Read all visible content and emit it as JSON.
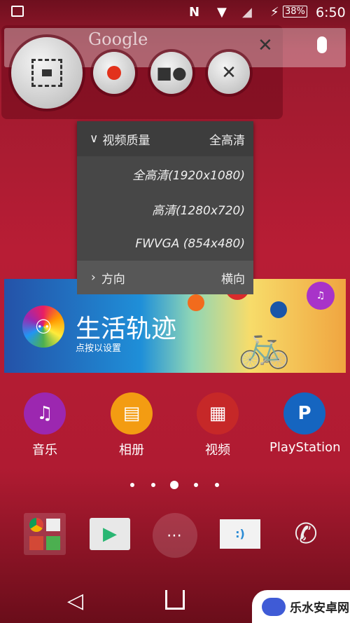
{
  "status_bar": {
    "time": "6:50",
    "battery": "38%",
    "icons": [
      "image-icon",
      "nfc-icon",
      "wifi-icon",
      "signal-icon",
      "charging-icon"
    ]
  },
  "search": {
    "placeholder": "Google"
  },
  "recorder": {
    "buttons": [
      "capture-screen-video-icon",
      "record-icon",
      "camera-person-icon",
      "settings-tools-icon"
    ],
    "record_color": "#e2321c"
  },
  "menu": {
    "header": {
      "label": "视频质量",
      "value": "全高清"
    },
    "options": [
      "全高清(1920x1080)",
      "高清(1280x720)",
      "FWVGA (854x480)"
    ],
    "orientation": {
      "label": "方向",
      "value": "横向"
    }
  },
  "banner": {
    "title": "生活轨迹",
    "subtitle": "点按以设置"
  },
  "apps": [
    {
      "label": "音乐",
      "color": "#9c27b0",
      "icon": "music-icon"
    },
    {
      "label": "相册",
      "color": "#f39c12",
      "icon": "album-icon"
    },
    {
      "label": "视频",
      "color": "#c62828",
      "icon": "film-icon"
    },
    {
      "label": "PlayStation",
      "color": "#1565c0",
      "icon": "playstation-icon"
    }
  ],
  "pages": {
    "count": 5,
    "current": 3
  },
  "dock": [
    "google-folder-icon",
    "play-store-icon",
    "app-drawer-icon",
    "messaging-icon",
    "phone-icon"
  ],
  "watermark": {
    "text": "乐水安卓网"
  }
}
